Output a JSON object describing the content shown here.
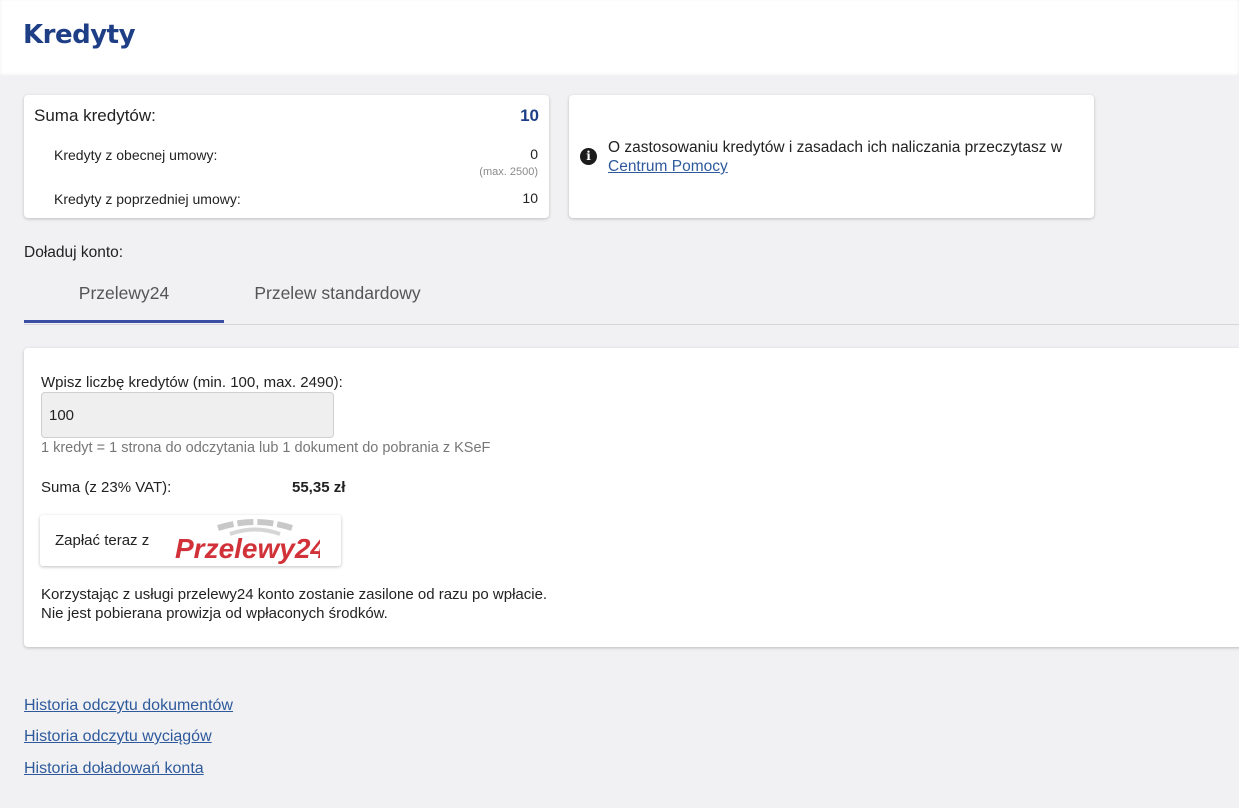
{
  "page": {
    "title": "Kredyty"
  },
  "credits": {
    "sum_label": "Suma kredytów:",
    "sum_value": "10",
    "current_label": "Kredyty z obecnej umowy:",
    "current_value": "0",
    "current_max": "(max. 2500)",
    "previous_label": "Kredyty z poprzedniej umowy:",
    "previous_value": "10"
  },
  "info": {
    "icon": "info-icon",
    "text": "O zastosowaniu kredytów i zasadach ich naliczania przeczytasz w ",
    "link": "Centrum Pomocy"
  },
  "topup": {
    "label": "Doładuj konto:",
    "tabs": [
      {
        "label": "Przelewy24",
        "active": true
      },
      {
        "label": "Przelew standardowy",
        "active": false
      }
    ]
  },
  "form": {
    "qty_label": "Wpisz liczbę kredytów (min. 100, max. 2490):",
    "qty_value": "100",
    "qty_hint": "1 kredyt = 1 strona do odczytania lub 1 dokument do pobrania z KSeF",
    "total_label": "Suma (z 23% VAT):",
    "total_value": "55,35 zł",
    "pay_label": "Zapłać teraz z",
    "pay_logo": "Przelewy24",
    "note_line1": "Korzystając z usługi przelewy24 konto zostanie zasilone od razu po wpłacie.",
    "note_line2": "Nie jest pobierana prowizja od wpłaconych środków."
  },
  "footer": {
    "links": [
      "Historia odczytu dokumentów",
      "Historia odczytu wyciągów",
      "Historia doładowań konta"
    ]
  },
  "colors": {
    "brand": "#1e3f86",
    "tab_indicator": "#3a4ea3",
    "link": "#2e5a9c",
    "logo_red": "#d13239"
  }
}
